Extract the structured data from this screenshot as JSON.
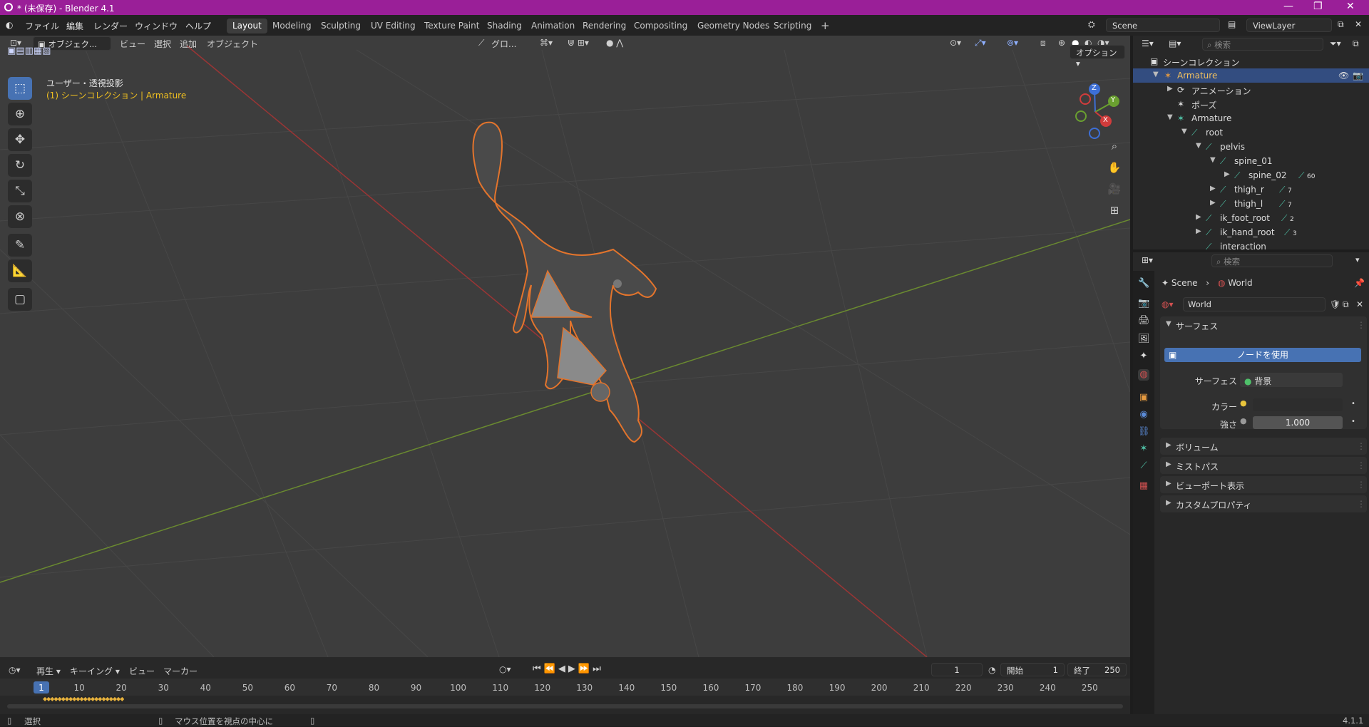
{
  "window": {
    "title": "* (未保存) - Blender 4.1",
    "minimize": "—",
    "restore": "❐",
    "close": "✕"
  },
  "menu": [
    "ファイル",
    "編集",
    "レンダー",
    "ウィンドウ",
    "ヘルプ"
  ],
  "workspaces": [
    "Layout",
    "Modeling",
    "Sculpting",
    "UV Editing",
    "Texture Paint",
    "Shading",
    "Animation",
    "Rendering",
    "Compositing",
    "Geometry Nodes",
    "Scripting"
  ],
  "workspace_add": "+",
  "scene": {
    "name": "Scene",
    "view_layer": "ViewLayer"
  },
  "viewport": {
    "mode": "オブジェク...",
    "menus": [
      "ビュー",
      "選択",
      "追加",
      "オブジェクト"
    ],
    "transform_orientation": "グロ...",
    "options": "オプション",
    "view_name": "ユーザー・透視投影",
    "collection_info": "(1) シーンコレクション | Armature",
    "gizmo": {
      "x": "X",
      "y": "Y",
      "z": "Z"
    }
  },
  "timeline": {
    "menus": [
      "再生",
      "キーイング",
      "ビュー",
      "マーカー"
    ],
    "current_frame": "1",
    "start_label": "開始",
    "start": "1",
    "end_label": "終了",
    "end": "250",
    "ticks": [
      "1",
      "10",
      "20",
      "30",
      "40",
      "50",
      "60",
      "70",
      "80",
      "90",
      "100",
      "110",
      "120",
      "130",
      "140",
      "150",
      "160",
      "170",
      "180",
      "190",
      "200",
      "210",
      "220",
      "230",
      "240",
      "250"
    ]
  },
  "status": {
    "select": "選択",
    "center": "マウス位置を視点の中心に",
    "version": "4.1.1"
  },
  "outliner": {
    "search_placeholder": "検索",
    "rows": [
      {
        "label": "シーンコレクション",
        "count": ""
      },
      {
        "label": "Armature",
        "count": ""
      },
      {
        "label": "アニメーション",
        "count": ""
      },
      {
        "label": "ポーズ",
        "count": ""
      },
      {
        "label": "Armature",
        "count": ""
      },
      {
        "label": "root",
        "count": ""
      },
      {
        "label": "pelvis",
        "count": ""
      },
      {
        "label": "spine_01",
        "count": ""
      },
      {
        "label": "spine_02",
        "count": "60"
      },
      {
        "label": "thigh_r",
        "count": "7"
      },
      {
        "label": "thigh_l",
        "count": "7"
      },
      {
        "label": "ik_foot_root",
        "count": "2"
      },
      {
        "label": "ik_hand_root",
        "count": "3"
      },
      {
        "label": "interaction",
        "count": ""
      }
    ]
  },
  "properties": {
    "search_placeholder": "検索",
    "breadcrumb_scene": "Scene",
    "breadcrumb_world": "World",
    "world_name": "World",
    "surface_panel": "サーフェス",
    "use_nodes": "ノードを使用",
    "surface_label": "サーフェス",
    "surface_value": "背景",
    "color_label": "カラー",
    "strength_label": "強さ",
    "strength_value": "1.000",
    "collapsed_panels": [
      "ボリューム",
      "ミストパス",
      "ビューポート表示",
      "カスタムプロパティ"
    ]
  }
}
